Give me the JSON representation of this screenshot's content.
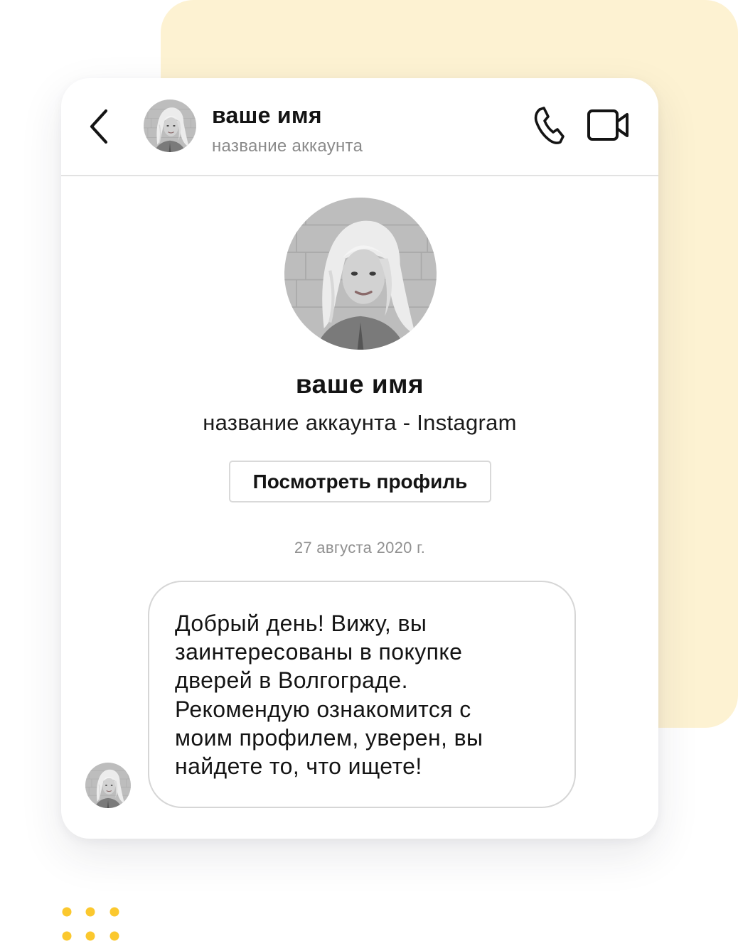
{
  "header": {
    "name": "ваше имя",
    "account": "название аккаунта"
  },
  "profile": {
    "name": "ваше имя",
    "account_line": "название аккаунта - Instagram",
    "view_button_label": "Посмотреть профиль"
  },
  "conversation": {
    "date": "27 августа 2020 г.",
    "messages": [
      {
        "text": "Добрый день! Вижу, вы\nзаинтересованы в покупке\nдверей в Волгограде.\nРекомендую ознакомится с\nмоим профилем, уверен, вы\nнайдете то, что ищете!"
      }
    ]
  },
  "icons": {
    "back": "chevron-left-icon",
    "call": "phone-icon",
    "video": "video-camera-icon",
    "avatar": "avatar-photo"
  },
  "colors": {
    "accent_yellow": "#fdf2d2",
    "dot_yellow": "#fbc82e",
    "card_background": "#ffffff",
    "divider": "#e2e2e2",
    "secondary_text": "#8a8a8a"
  }
}
